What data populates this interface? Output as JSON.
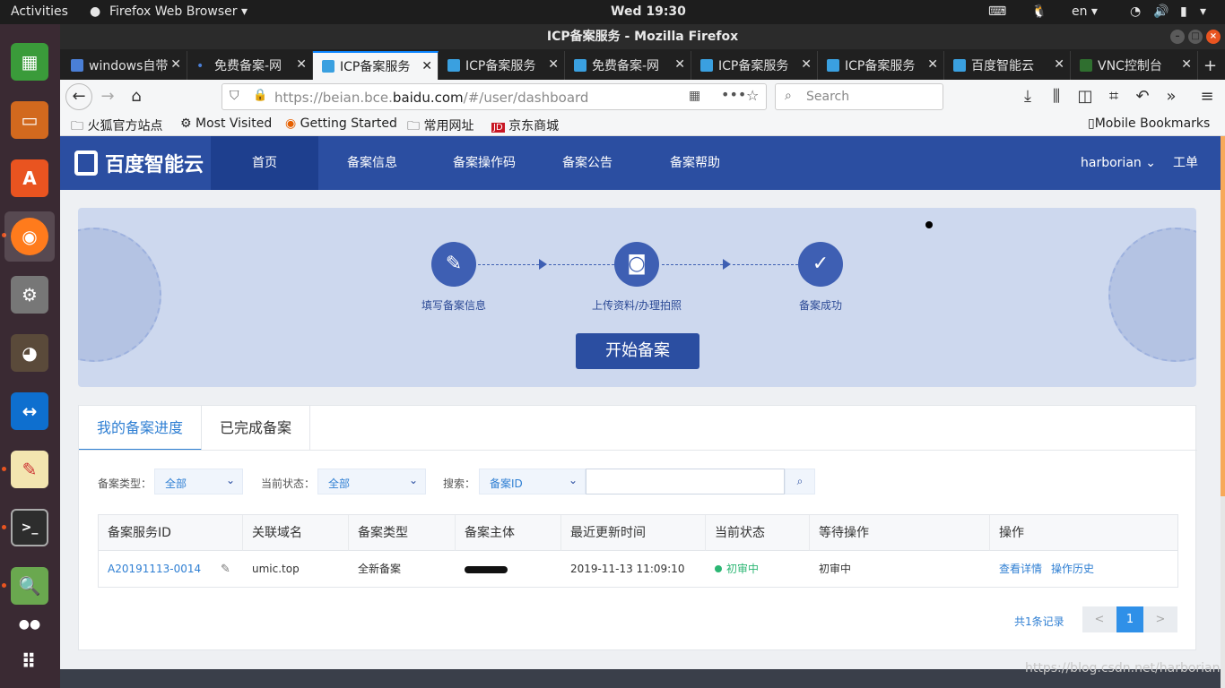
{
  "os": {
    "activities": "Activities",
    "app_menu": "Firefox Web Browser ▾",
    "clock": "Wed 19:30",
    "lang": "en ▾"
  },
  "window": {
    "title": "ICP备案服务 - Mozilla Firefox"
  },
  "tabs": [
    {
      "label": "windows自带",
      "active": false
    },
    {
      "label": "免费备案-网",
      "active": false
    },
    {
      "label": "ICP备案服务",
      "active": true
    },
    {
      "label": "ICP备案服务",
      "active": false
    },
    {
      "label": "免费备案-网",
      "active": false
    },
    {
      "label": "ICP备案服务",
      "active": false
    },
    {
      "label": "ICP备案服务",
      "active": false
    },
    {
      "label": "百度智能云",
      "active": false
    },
    {
      "label": "VNC控制台",
      "active": false
    }
  ],
  "navbar": {
    "url_prefix": "https://beian.bce.",
    "url_domain": "baidu.com",
    "url_suffix": "/#/user/dashboard",
    "search_placeholder": "Search"
  },
  "bookmarks": {
    "items": [
      "火狐官方站点",
      "Most Visited",
      "Getting Started",
      "常用网址",
      "京东商城"
    ],
    "mobile": "Mobile Bookmarks"
  },
  "site": {
    "logo_text": "百度智能云",
    "nav": [
      "首页",
      "备案信息",
      "备案操作码",
      "备案公告",
      "备案帮助"
    ],
    "user": "harborian ⌄",
    "worklist": "工单"
  },
  "banner": {
    "steps": [
      "填写备案信息",
      "上传资料/办理拍照",
      "备案成功"
    ],
    "start_button": "开始备案"
  },
  "panel": {
    "tabs": [
      "我的备案进度",
      "已完成备案"
    ],
    "filters": {
      "type_label": "备案类型：",
      "type_value": "全部",
      "status_label": "当前状态：",
      "status_value": "全部",
      "search_label": "搜索：",
      "search_field": "备案ID"
    },
    "table": {
      "headers": [
        "备案服务ID",
        "关联域名",
        "备案类型",
        "备案主体",
        "最近更新时间",
        "当前状态",
        "等待操作",
        "操作"
      ],
      "rows": [
        {
          "id": "A20191113-0014",
          "domain": "umic.top",
          "type": "全新备案",
          "updated": "2019-11-13 11:09:10",
          "status": "初审中",
          "waiting": "初审中",
          "action_detail": "查看详情",
          "action_history": "操作历史"
        }
      ]
    },
    "pagination": {
      "total": "共1条记录",
      "prev": "<",
      "current": "1",
      "next": ">"
    }
  },
  "watermark": "https://blog.csdn.net/harborian",
  "colors": {
    "brand": "#2b4ea1",
    "link": "#2f7fd3",
    "status_ok": "#2bb673",
    "ubuntu_accent": "#e95420"
  }
}
